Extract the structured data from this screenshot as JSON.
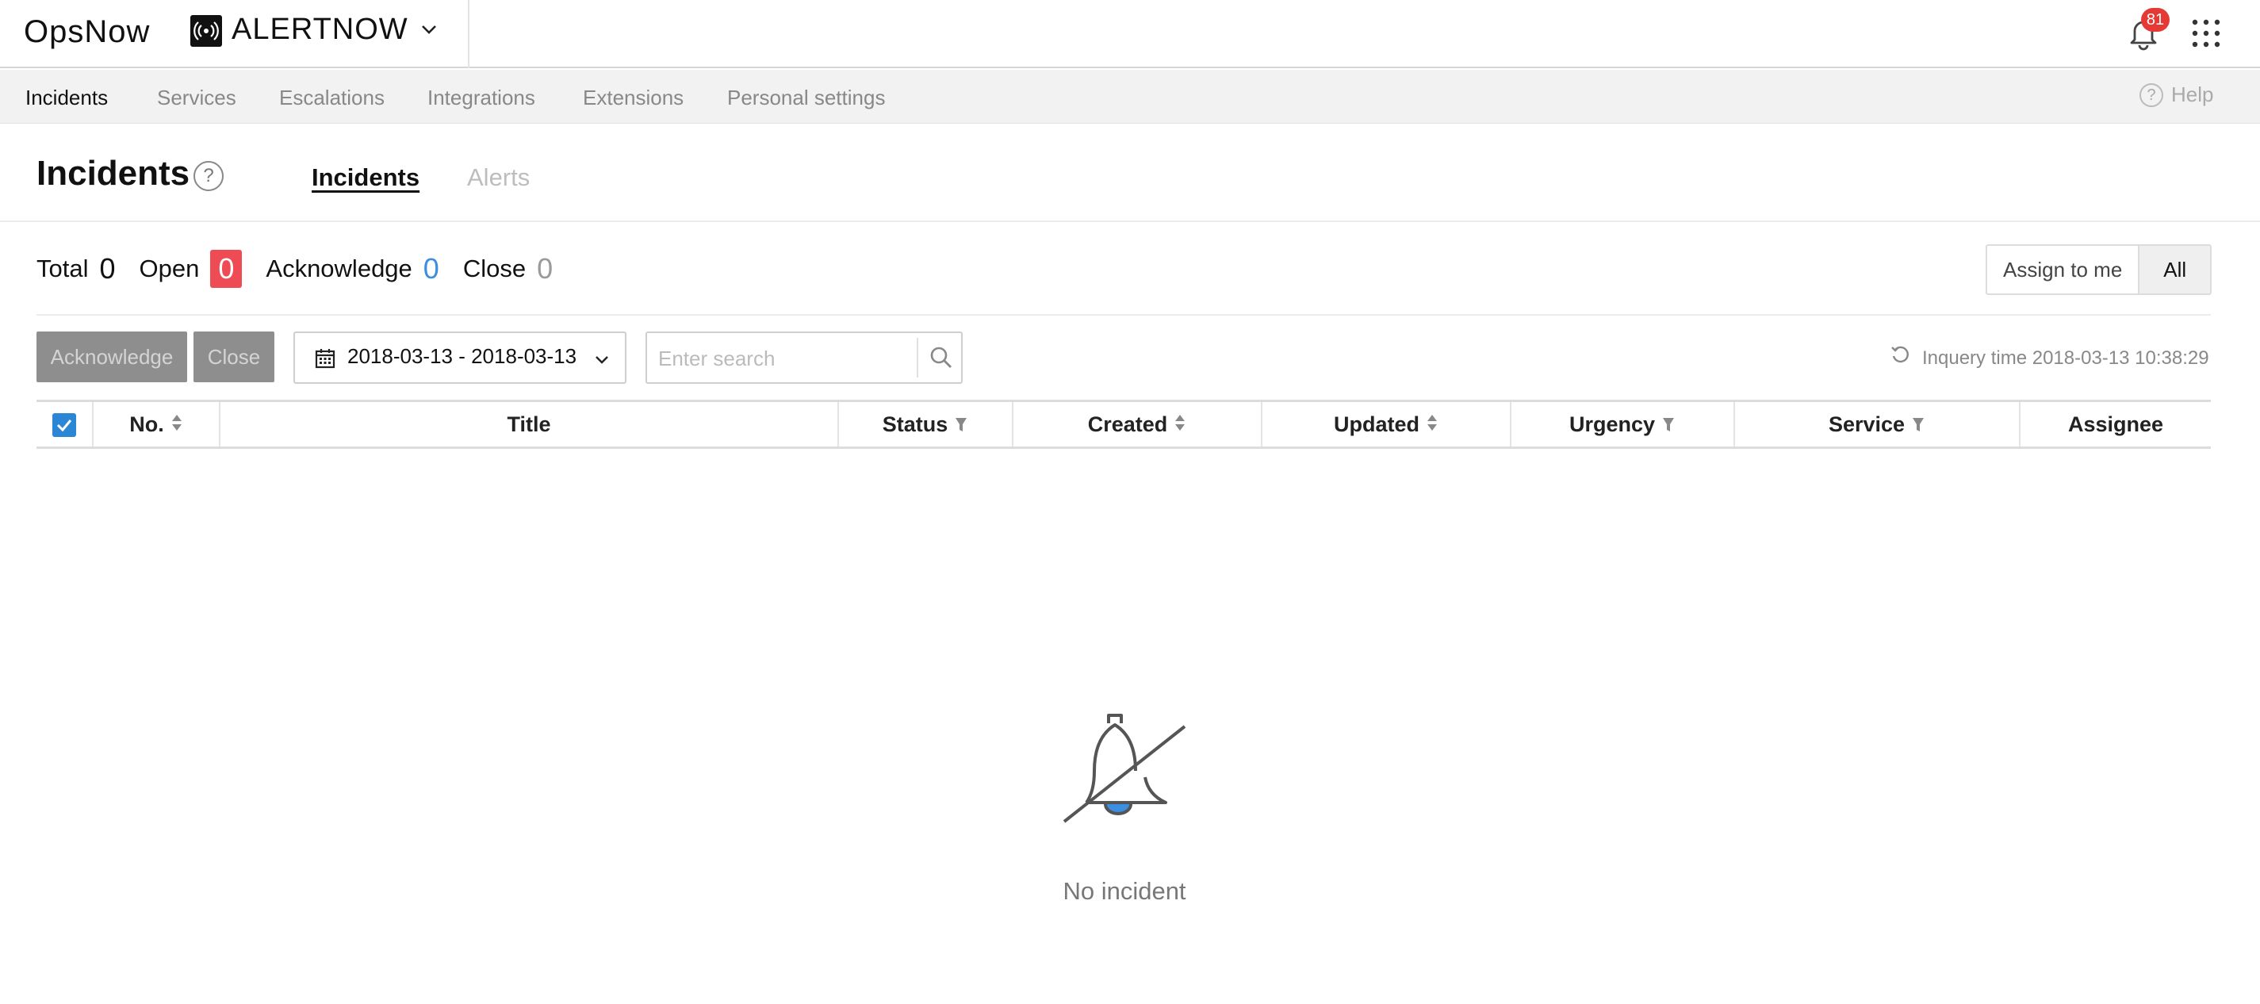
{
  "header": {
    "logo": "OpsNow",
    "product": "ALERTNOW",
    "notification_count": "81",
    "icons": {
      "bell": "bell-icon",
      "apps": "apps-grid-icon",
      "broadcast": "broadcast-icon"
    }
  },
  "nav": {
    "items": [
      {
        "label": "Incidents",
        "active": true
      },
      {
        "label": "Services",
        "active": false
      },
      {
        "label": "Escalations",
        "active": false
      },
      {
        "label": "Integrations",
        "active": false
      },
      {
        "label": "Extensions",
        "active": false
      },
      {
        "label": "Personal settings",
        "active": false
      }
    ],
    "help_label": "Help"
  },
  "page": {
    "title": "Incidents",
    "tabs": [
      {
        "label": "Incidents",
        "active": true
      },
      {
        "label": "Alerts",
        "active": false
      }
    ]
  },
  "counts": {
    "total_label": "Total",
    "total": "0",
    "open_label": "Open",
    "open": "0",
    "ack_label": "Acknowledge",
    "ack": "0",
    "close_label": "Close",
    "close": "0"
  },
  "filter_toggle": {
    "assign_to_me": "Assign to me",
    "all": "All",
    "selected": "All"
  },
  "toolbar": {
    "acknowledge_label": "Acknowledge",
    "close_label": "Close",
    "date_range": "2018-03-13 - 2018-03-13",
    "search_placeholder": "Enter search",
    "search_value": "",
    "inquery": "Inquery time 2018-03-13 10:38:29"
  },
  "table": {
    "columns": [
      {
        "label": "No.",
        "sortable": true,
        "filterable": false
      },
      {
        "label": "Title",
        "sortable": false,
        "filterable": false
      },
      {
        "label": "Status",
        "sortable": false,
        "filterable": true
      },
      {
        "label": "Created",
        "sortable": true,
        "filterable": false
      },
      {
        "label": "Updated",
        "sortable": true,
        "filterable": false
      },
      {
        "label": "Urgency",
        "sortable": false,
        "filterable": true
      },
      {
        "label": "Service",
        "sortable": false,
        "filterable": true
      },
      {
        "label": "Assignee",
        "sortable": false,
        "filterable": false
      }
    ],
    "rows": [],
    "select_all_checked": true
  },
  "empty_state": {
    "icon": "bell-off-icon",
    "message": "No incident"
  },
  "colors": {
    "accent_blue": "#2b86d6",
    "open_red": "#ee4b55",
    "ack_blue": "#3b8ee0",
    "badge_red": "#e53935",
    "disabled_button": "#8e8e8e"
  }
}
